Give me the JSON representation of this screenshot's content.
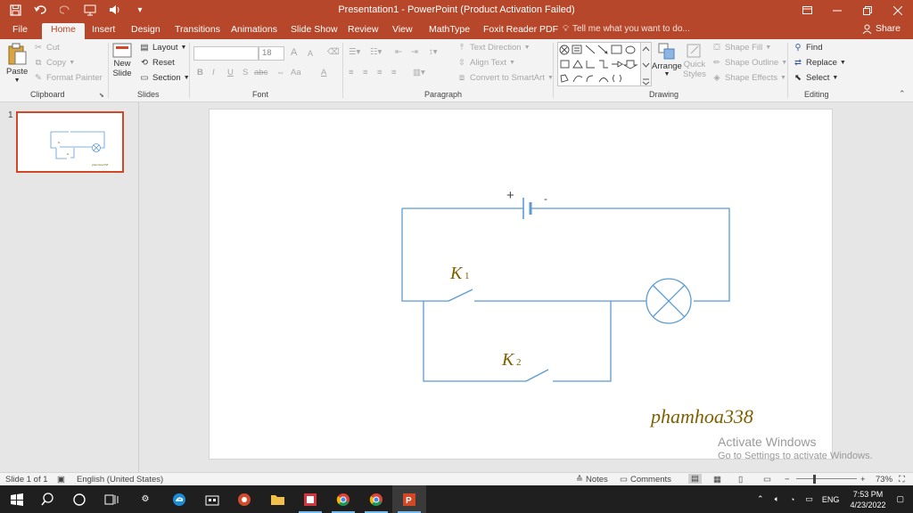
{
  "window": {
    "title": "Presentation1 - PowerPoint (Product Activation Failed)",
    "qat_icons": [
      "save-icon",
      "undo-icon",
      "redo-icon",
      "presenter-icon",
      "speaker-icon",
      "customize-qat-icon"
    ],
    "controls": [
      "ribbon-display-icon",
      "minimize-icon",
      "restore-icon",
      "close-icon"
    ]
  },
  "tabs": [
    "File",
    "Home",
    "Insert",
    "Design",
    "Transitions",
    "Animations",
    "Slide Show",
    "Review",
    "View",
    "MathType",
    "Foxit Reader PDF"
  ],
  "active_tab": "Home",
  "tell_me": "Tell me what you want to do...",
  "share": "Share",
  "ribbon": {
    "clipboard": {
      "label": "Clipboard",
      "paste": "Paste",
      "cut": "Cut",
      "copy": "Copy",
      "format_painter": "Format Painter"
    },
    "slides": {
      "label": "Slides",
      "new_slide_1": "New",
      "new_slide_2": "Slide",
      "layout": "Layout",
      "reset": "Reset",
      "section": "Section"
    },
    "font": {
      "label": "Font",
      "size": "18",
      "bold": "B",
      "italic": "I",
      "underline": "U",
      "strike": "S",
      "char_spacing": "abc",
      "case": "Aa",
      "color": "A",
      "grow": "A",
      "shrink": "A"
    },
    "paragraph": {
      "label": "Paragraph",
      "text_direction": "Text Direction",
      "align_text": "Align Text",
      "smartart": "Convert to SmartArt"
    },
    "drawing": {
      "label": "Drawing",
      "arrange": "Arrange",
      "quick_styles_1": "Quick",
      "quick_styles_2": "Styles",
      "shape_fill": "Shape Fill",
      "shape_outline": "Shape Outline",
      "shape_effects": "Shape Effects"
    },
    "editing": {
      "label": "Editing",
      "find": "Find",
      "replace": "Replace",
      "select": "Select"
    }
  },
  "thumbnail": {
    "number": "1"
  },
  "slide": {
    "plus": "+",
    "minus": "-",
    "k1": "K",
    "k1_sub": "1",
    "k2": "K",
    "k2_sub": "2",
    "signature": "phamhoa338",
    "colors": {
      "wire": "#5b9bd5",
      "text": "#7f6000"
    }
  },
  "activation": {
    "title": "Activate Windows",
    "subtitle": "Go to Settings to activate Windows."
  },
  "status": {
    "slide": "Slide 1 of 1",
    "language": "English (United States)",
    "notes": "Notes",
    "comments": "Comments",
    "zoom": "73%"
  },
  "taskbar": {
    "apps": [
      "start-icon",
      "search-icon",
      "cortana-icon",
      "task-view-icon",
      "settings-icon",
      "edge-icon",
      "store-icon",
      "app-icon",
      "file-explorer-icon",
      "media-app-icon",
      "chrome-icon",
      "chrome-icon",
      "powerpoint-icon"
    ],
    "tray": {
      "language": "ENG",
      "time": "7:53 PM",
      "date": "4/23/2022"
    }
  }
}
